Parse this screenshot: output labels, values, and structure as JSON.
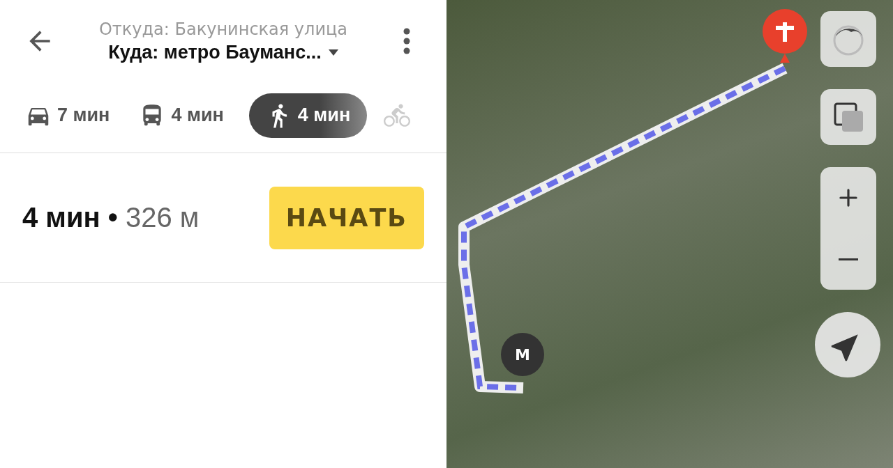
{
  "header": {
    "from": "Откуда: Бакунинская улица",
    "to": "Куда: метро Бауманс..."
  },
  "modes": [
    {
      "kind": "car",
      "label": "7 мин",
      "selected": false
    },
    {
      "kind": "bus",
      "label": "4 мин",
      "selected": false
    },
    {
      "kind": "walk",
      "label": "4 мин",
      "selected": true
    },
    {
      "kind": "bike",
      "selected": false
    }
  ],
  "summary": {
    "time": "4 мин",
    "separator": "•",
    "distance": "326 м"
  },
  "start_button": "НАЧАТЬ",
  "map": {
    "metro_badge": "М"
  }
}
